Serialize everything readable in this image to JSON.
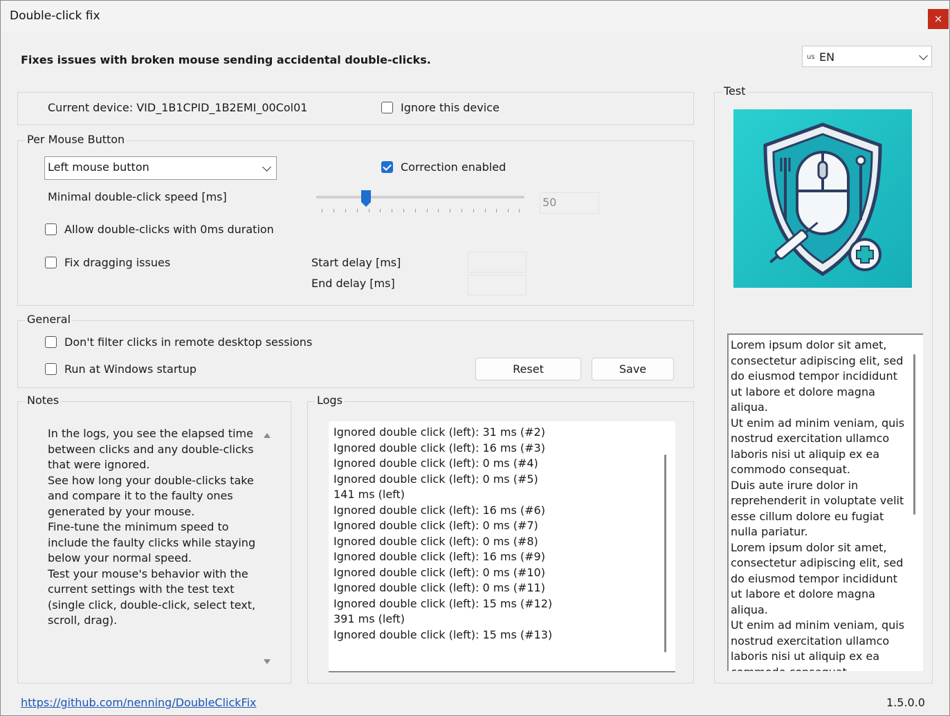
{
  "window": {
    "title": "Double-click fix",
    "close_glyph": "×"
  },
  "heading": "Fixes issues with broken mouse sending accidental double-clicks.",
  "language": {
    "flag": "us",
    "value": "EN"
  },
  "device": {
    "label": "Current device: VID_1B1CPID_1B2EMI_00Col01",
    "ignore_label": "Ignore this device",
    "ignore_checked": false
  },
  "per_button": {
    "group_label": "Per Mouse Button",
    "button_select": "Left mouse button",
    "correction_label": "Correction enabled",
    "correction_checked": true,
    "min_speed_label": "Minimal double-click speed [ms]",
    "slider_value": 50,
    "speed_field_value": "50",
    "allow_zero_label": "Allow double-clicks with 0ms duration",
    "allow_zero_checked": false,
    "fix_dragging_label": "Fix dragging issues",
    "fix_dragging_checked": false,
    "start_delay_label": "Start delay [ms]",
    "end_delay_label": "End delay [ms]",
    "start_delay_value": "",
    "end_delay_value": ""
  },
  "general": {
    "group_label": "General",
    "remote_label": "Don't filter clicks in remote desktop sessions",
    "remote_checked": false,
    "startup_label": "Run at Windows startup",
    "startup_checked": false,
    "reset_label": "Reset",
    "save_label": "Save"
  },
  "notes": {
    "group_label": "Notes",
    "lines": [
      "In the logs, you see the elapsed time",
      "between clicks and any double-clicks",
      "that were ignored.",
      "See how long your double-clicks take",
      "and compare it to the faulty ones",
      "generated by your mouse.",
      "Fine-tune the minimum speed to",
      "include the faulty clicks while staying",
      "below your normal speed.",
      "Test your mouse's behavior with the",
      "current settings with the test text",
      "(single click, double-click, select text,",
      "scroll, drag)."
    ]
  },
  "logs": {
    "group_label": "Logs",
    "lines": [
      "Ignored double click (left): 31 ms (#2)",
      "Ignored double click (left): 16 ms (#3)",
      "Ignored double click (left): 0 ms (#4)",
      "Ignored double click (left): 0 ms (#5)",
      "141 ms (left)",
      "Ignored double click (left): 16 ms (#6)",
      "Ignored double click (left): 0 ms (#7)",
      "Ignored double click (left): 0 ms (#8)",
      "Ignored double click (left): 16 ms (#9)",
      "Ignored double click (left): 0 ms (#10)",
      "Ignored double click (left): 0 ms (#11)",
      "Ignored double click (left): 15 ms (#12)",
      "391 ms (left)",
      "Ignored double click (left): 15 ms (#13)"
    ]
  },
  "test": {
    "group_label": "Test",
    "image_icon": "shield-mouse-icon",
    "text_lines": [
      "Lorem ipsum dolor sit amet,",
      "consectetur adipiscing elit, sed",
      "do eiusmod tempor incididunt",
      "ut labore et dolore magna",
      "aliqua.",
      "Ut enim ad minim veniam, quis",
      "nostrud exercitation ullamco",
      "laboris nisi ut aliquip ex ea",
      "commodo consequat.",
      "Duis aute irure dolor in",
      "reprehenderit in voluptate velit",
      "esse cillum dolore eu fugiat",
      "nulla pariatur.",
      " Lorem ipsum dolor sit amet,",
      "consectetur adipiscing elit, sed",
      "do eiusmod tempor incididunt",
      "ut labore et dolore magna",
      "aliqua.",
      "Ut enim ad minim veniam, quis",
      "nostrud exercitation ullamco",
      "laboris nisi ut aliquip ex ea",
      "commodo consequat."
    ]
  },
  "footer": {
    "link": "https://github.com/nenning/DoubleClickFix",
    "version": "1.5.0.0"
  },
  "colors": {
    "accent": "#1e6fcf",
    "close": "#c42b1c",
    "image_bg": "#22c4c4"
  }
}
